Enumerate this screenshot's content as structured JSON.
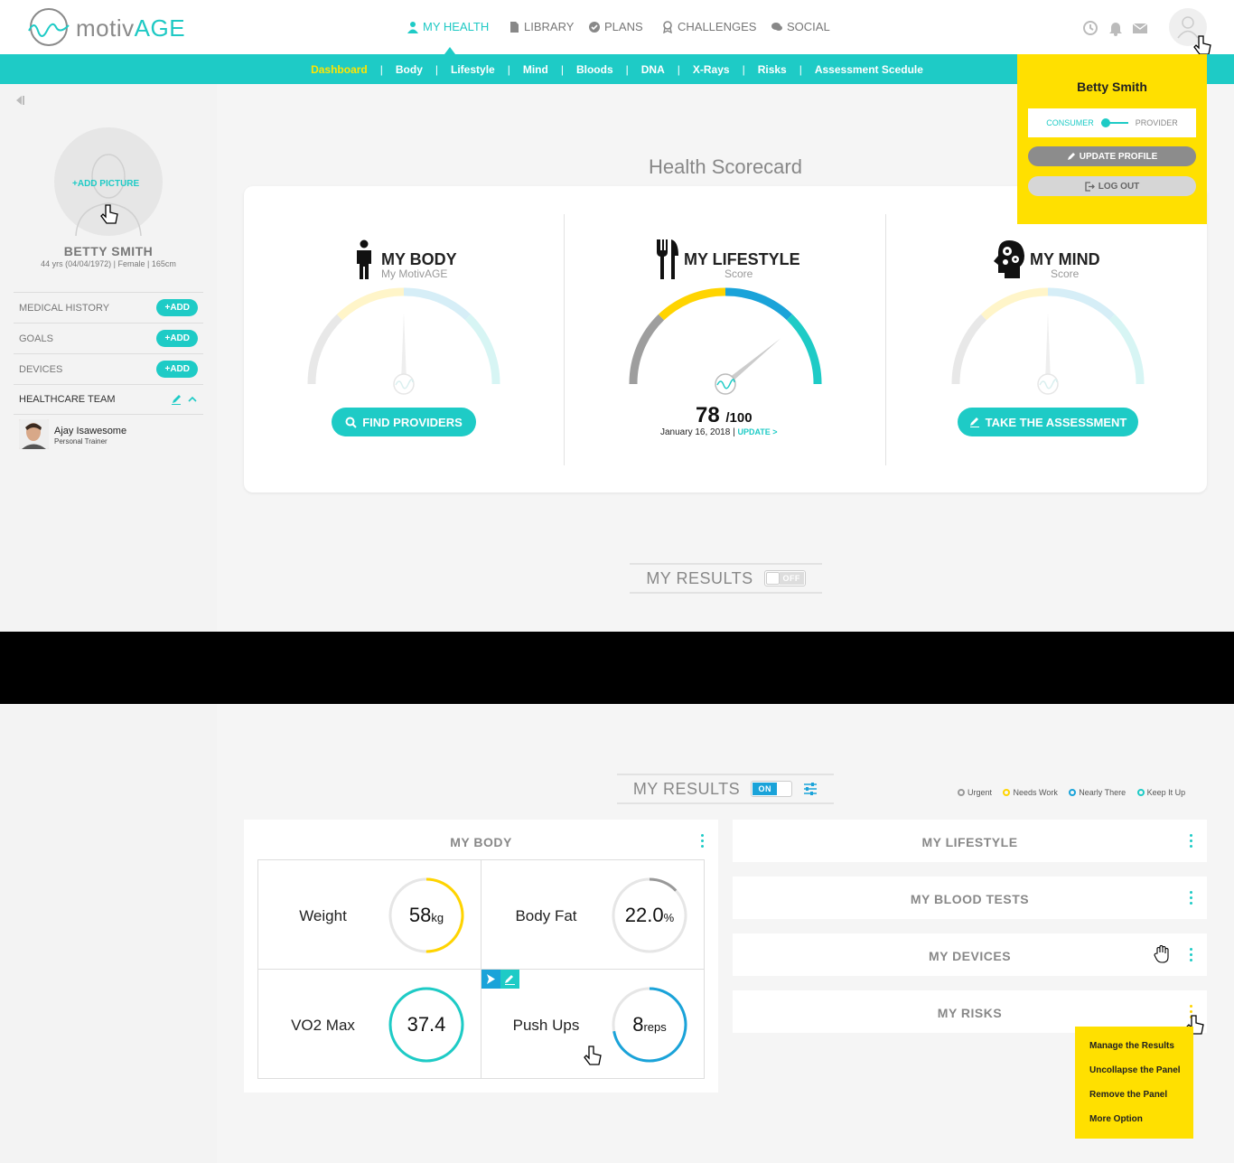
{
  "brand": {
    "logo_a": "motiv",
    "logo_b": "AGE"
  },
  "nav": [
    {
      "label": "MY HEALTH",
      "icon": "person-icon"
    },
    {
      "label": "LIBRARY",
      "icon": "document-icon"
    },
    {
      "label": "PLANS",
      "icon": "check-circle-icon"
    },
    {
      "label": "CHALLENGES",
      "icon": "award-icon"
    },
    {
      "label": "SOCIAL",
      "icon": "chat-icon"
    }
  ],
  "subnav": [
    "Dashboard",
    "Body",
    "Lifestyle",
    "Mind",
    "Bloods",
    "DNA",
    "X-Rays",
    "Risks",
    "Assessment Scedule"
  ],
  "sidebar": {
    "add_picture": "ADD PICTURE",
    "name": "BETTY SMITH",
    "details": "44 yrs (04/04/1972)  |  Female  |  165cm",
    "rows": [
      {
        "label": "MEDICAL HISTORY",
        "btn": "ADD"
      },
      {
        "label": "GOALS",
        "btn": "ADD"
      },
      {
        "label": "DEVICES",
        "btn": "ADD"
      }
    ],
    "team_label": "HEALTHCARE TEAM",
    "member": {
      "name": "Ajay Isawesome",
      "role": "Personal Trainer"
    }
  },
  "scorecard": {
    "title": "Health Scorecard",
    "body": {
      "title": "MY BODY",
      "sub": "My MotivAGE",
      "btn": "FIND PROVIDERS"
    },
    "lifestyle": {
      "title": "MY LIFESTYLE",
      "sub": "Score",
      "score": "78",
      "max": "/100",
      "date": "January 16, 2018",
      "sep": "|",
      "update": "UPDATE >",
      "score_value": 78
    },
    "mind": {
      "title": "MY MIND",
      "sub": "Score",
      "btn": "TAKE THE ASSESSMENT"
    }
  },
  "results_off": {
    "label": "MY RESULTS",
    "toggle": "OFF"
  },
  "results_on": {
    "label": "MY RESULTS",
    "toggle": "ON"
  },
  "legend": [
    {
      "label": "Urgent",
      "color": "#999999"
    },
    {
      "label": "Needs Work",
      "color": "#ffd400"
    },
    {
      "label": "Nearly There",
      "color": "#1aa3d9"
    },
    {
      "label": "Keep It Up",
      "color": "#1ecbc6"
    }
  ],
  "body_panel": {
    "title": "MY BODY",
    "metrics": [
      {
        "label": "Weight",
        "value": "58",
        "unit": "kg",
        "progress": 0.5,
        "color": "#ffd400"
      },
      {
        "label": "Body Fat",
        "value": "22.0",
        "unit": "%",
        "progress": 0.13,
        "color": "#999999"
      },
      {
        "label": "VO2 Max",
        "value": "37.4",
        "unit": "",
        "progress": 1.0,
        "color": "#1ecbc6"
      },
      {
        "label": "Push Ups",
        "value": "8",
        "unit": "reps",
        "progress": 0.72,
        "color": "#1aa3d9"
      }
    ]
  },
  "right_panels": [
    "MY LIFESTYLE",
    "MY BLOOD TESTS",
    "MY DEVICES",
    "MY RISKS"
  ],
  "user_popup": {
    "name": "Betty Smith",
    "consumer": "CONSUMER",
    "provider": "PROVIDER",
    "update": "UPDATE PROFILE",
    "logout": "LOG OUT"
  },
  "menu_popup": [
    "Manage the Results",
    "Uncollapse the Panel",
    "Remove the Panel",
    "More Option"
  ],
  "colors": {
    "accent": "#1ecbc6",
    "yellow": "#ffd400",
    "blue": "#1aa3d9",
    "grey": "#999999"
  }
}
